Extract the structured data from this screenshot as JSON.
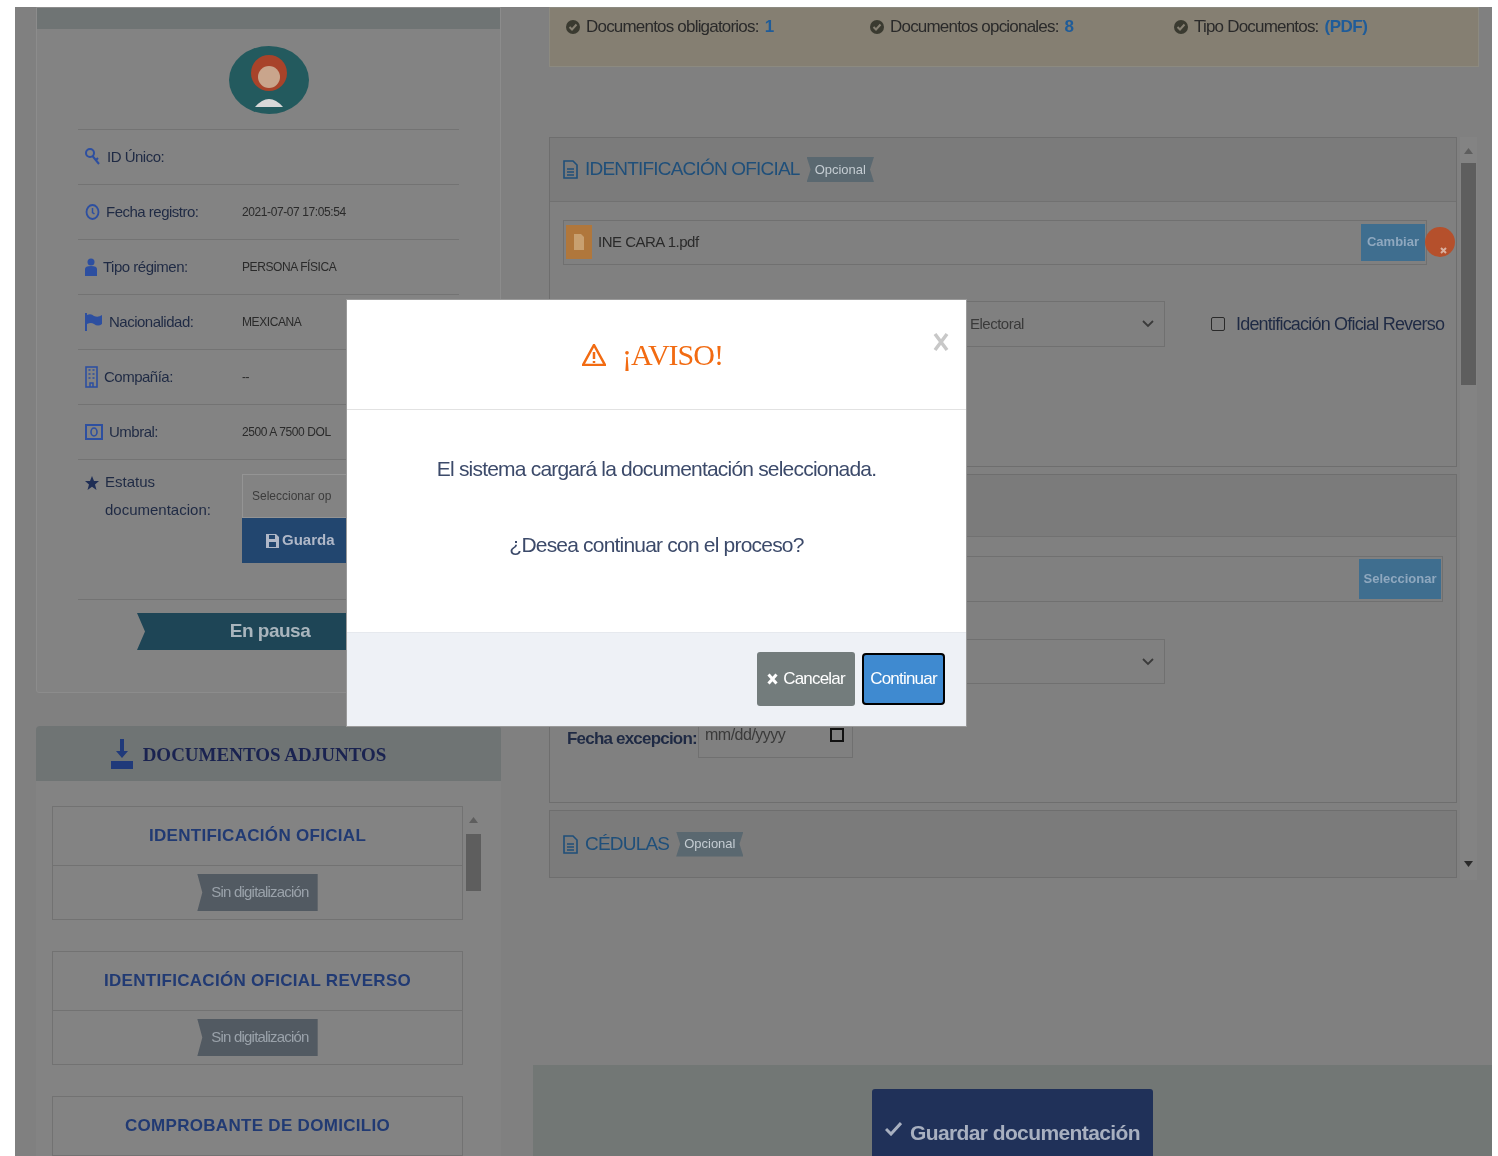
{
  "profile": {
    "fields": [
      {
        "label": "ID Único:"
      },
      {
        "label": "Fecha registro:",
        "value": "2021-07-07 17:05:54"
      },
      {
        "label": "Tipo régimen:",
        "value": "PERSONA FÍSICA"
      },
      {
        "label": "Nacionalidad:",
        "value": "MEXICANA"
      },
      {
        "label": "Compañía:",
        "value": "--"
      },
      {
        "label": "Umbral:",
        "value": "2500 A 7500 DOL"
      }
    ],
    "status": {
      "label": "Estatus documentacion:",
      "select_placeholder": "Seleccionar op",
      "save_button": "Guarda"
    },
    "ribbon": "En pausa"
  },
  "attachments": {
    "title": "DOCUMENTOS ADJUNTOS",
    "items": [
      {
        "title": "IDENTIFICACIÓN OFICIAL",
        "status": "Sin digitalización"
      },
      {
        "title": "IDENTIFICACIÓN OFICIAL REVERSO",
        "status": "Sin digitalización"
      },
      {
        "title": "COMPROBANTE DE DOMICILIO"
      }
    ]
  },
  "summary": [
    {
      "label": "Documentos obligatorios:",
      "value": "1"
    },
    {
      "label": "Documentos opcionales:",
      "value": "8"
    },
    {
      "label": "Tipo Documentos:",
      "value": "(PDF)"
    }
  ],
  "sections": {
    "first": {
      "title": "IDENTIFICACIÓN OFICIAL",
      "badge": "Opcional",
      "file": "INE CARA 1.pdf",
      "file_button": "Cambiar",
      "select_value": "Electoral",
      "checkbox": {
        "label": "Identificación Oficial Reverso",
        "checked": false
      }
    },
    "second": {
      "file_button": "Seleccionar",
      "date_label": "Fecha excepcion:",
      "date_placeholder": "mm/dd/yyyy"
    },
    "third": {
      "title": "CÉDULAS",
      "badge": "Opcional"
    }
  },
  "save_documents_button": "Guardar documentación",
  "modal": {
    "title": "¡AVISO!",
    "messages": [
      "El sistema cargará la documentación seleccionada.",
      "¿Desea continuar con el proceso?"
    ],
    "cancel_button": "Cancelar",
    "continue_button": "Continuar"
  }
}
